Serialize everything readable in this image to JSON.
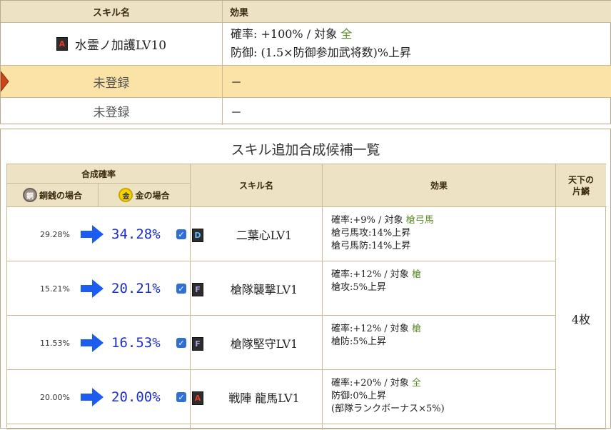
{
  "current_skills": {
    "headers": {
      "name": "スキル名",
      "effect": "効果"
    },
    "rows": [
      {
        "rank": "A",
        "name": "水霊ノ加護LV10",
        "effect_line1_prefix": "確率: +100%  /  対象 ",
        "effect_line1_target": "全",
        "effect_line2": "防御: (1.5×防御参加武将数)%上昇"
      },
      {
        "name": "未登録",
        "effect": "－"
      },
      {
        "name": "未登録",
        "effect": "－"
      }
    ]
  },
  "candidates": {
    "title": "スキル追加合成候補一覧",
    "headers": {
      "rate": "合成確率",
      "copper": "銅銭の場合",
      "copper_coin": "銅",
      "gold": "金の場合",
      "gold_coin": "金",
      "name": "スキル名",
      "effect": "効果",
      "scale_line1": "天下の",
      "scale_line2": "片鱗"
    },
    "scale_value": "4枚",
    "rows": [
      {
        "copper": "29.28%",
        "gold": "34.28%",
        "rank": "D",
        "name": "二葉心LV1",
        "l1_prefix": "確率:+9%  /  対象 ",
        "l1_target": "槍弓馬",
        "l2": "槍弓馬攻:14%上昇",
        "l3": "槍弓馬防:14%上昇"
      },
      {
        "copper": "15.21%",
        "gold": "20.21%",
        "rank": "F",
        "name": "槍隊襲撃LV1",
        "l1_prefix": "確率:+12%  /  対象 ",
        "l1_target": "槍",
        "l2": "槍攻:5%上昇",
        "l3": ""
      },
      {
        "copper": "11.53%",
        "gold": "16.53%",
        "rank": "F",
        "name": "槍隊堅守LV1",
        "l1_prefix": "確率:+12%  /  対象 ",
        "l1_target": "槍",
        "l2": "槍防:5%上昇",
        "l3": ""
      },
      {
        "copper": "20.00%",
        "gold": "20.00%",
        "rank": "A",
        "name": "戦陣 龍馬LV1",
        "l1_prefix": "確率:+20%  /  対象 ",
        "l1_target": "全",
        "l2": "防御:0%上昇",
        "l3": "(部隊ランクボーナス×5%)"
      }
    ],
    "checkbox_mark": "✓"
  },
  "colors": {
    "header_bg": "#ede2c4",
    "selected_row_bg": "#fbe3a8",
    "border": "#c9b994",
    "big_pct": "#1c2fc8",
    "arrow": "#1c5cf0",
    "target_green": "#5f8a2a"
  }
}
